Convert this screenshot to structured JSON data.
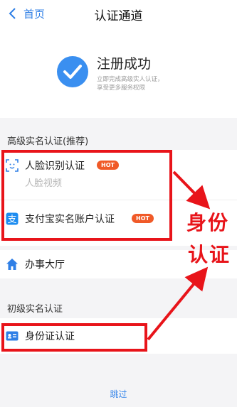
{
  "nav": {
    "back_label": "首页",
    "title": "认证通道"
  },
  "success": {
    "title": "注册成功",
    "subtitle_line1": "立即完成高级实人认证，",
    "subtitle_line2": "享受更多服务权限"
  },
  "advanced": {
    "header": "高级实名认证(推荐)",
    "items": [
      {
        "label": "人脸识别认证",
        "badge": "HOT",
        "sublabel": "人脸视频",
        "icon": "face-scan-icon"
      },
      {
        "label": "支付宝实名账户认证",
        "badge": "HOT",
        "icon": "alipay-icon"
      }
    ]
  },
  "hall": {
    "label": "办事大厅",
    "icon": "home-icon"
  },
  "basic": {
    "header": "初级实名认证",
    "items": [
      {
        "label": "身份证认证",
        "icon": "id-card-icon"
      }
    ]
  },
  "annotation": {
    "line1": "身份",
    "line2": "认证"
  },
  "footer": {
    "skip_label": "跳过"
  },
  "colors": {
    "accent": "#2f7fe6",
    "hot": "#f05a28",
    "annotation_red": "#e8141a",
    "background": "#f4f4f6"
  }
}
